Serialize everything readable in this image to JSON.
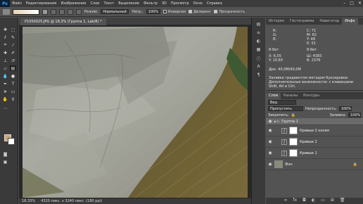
{
  "app": {
    "logo": "Ps"
  },
  "menu": [
    "Файл",
    "Редактирование",
    "Изображение",
    "Слои",
    "Текст",
    "Выделение",
    "Фильтр",
    "3D",
    "Просмотр",
    "Окно",
    "Справка"
  ],
  "window_controls": [
    "–",
    "□",
    "✕"
  ],
  "options": {
    "mode_label": "Режим:",
    "mode_value": "Нормальный",
    "opacity_label": "Непр.:",
    "opacity_value": "100%",
    "inverse_label": "Инверсия",
    "dither_label": "Дизеринг",
    "transparency_label": "Прозрачность"
  },
  "document": {
    "tab_title": "P1050025.JPG @ 18,3% (Группа 1, Lab/8) *",
    "zoom": "18,33%",
    "dimensions": "4320 пикс. x 3240 пикс. (180 ppi)"
  },
  "panels": {
    "top_tabs": [
      "История",
      "Гистограмма",
      "Навигатор",
      "Инфо"
    ],
    "bottom_tabs": [
      "Слои",
      "Каналы",
      "Контуры"
    ]
  },
  "info": {
    "rgb_labels": [
      "R:",
      "G:",
      "B:"
    ],
    "rgb_values": [
      "",
      "",
      ""
    ],
    "cmyk_labels": [
      "C:",
      "M:",
      "Y:",
      "K:"
    ],
    "cmyk_values": [
      "71",
      "62",
      "48",
      "51"
    ],
    "bit_left": "8-бит",
    "bit_right": "8-бит",
    "x_label": "X:",
    "x_value": "6,55",
    "y_label": "Y:",
    "y_value": "10,83",
    "w_label": "Ш:",
    "h_label": "В:",
    "w_value": "4383",
    "h_value": "2376",
    "doc_size": "Док: 40,0M/40,0M",
    "hint": "Заливка градиентом методом буксировки. Дополнительные возможности: с клавишами Shift, Alt и Ctrl."
  },
  "layers": {
    "kind_label": "Вид",
    "blend_mode": "Пропустить",
    "opacity_label": "Непрозрачность:",
    "opacity_value": "100%",
    "lock_label": "Закрепить:",
    "fill_label": "Заливка:",
    "fill_value": "100%",
    "items": [
      {
        "name": "Группа 1",
        "type": "group"
      },
      {
        "name": "Кривые 2 копия",
        "type": "adjustment"
      },
      {
        "name": "Кривые 2",
        "type": "adjustment"
      },
      {
        "name": "Кривые 1",
        "type": "adjustment"
      },
      {
        "name": "Фон",
        "type": "background"
      }
    ]
  },
  "colors": {
    "foreground": "#c7a77b",
    "background": "#ffffff",
    "accent": "#31a8ff"
  }
}
